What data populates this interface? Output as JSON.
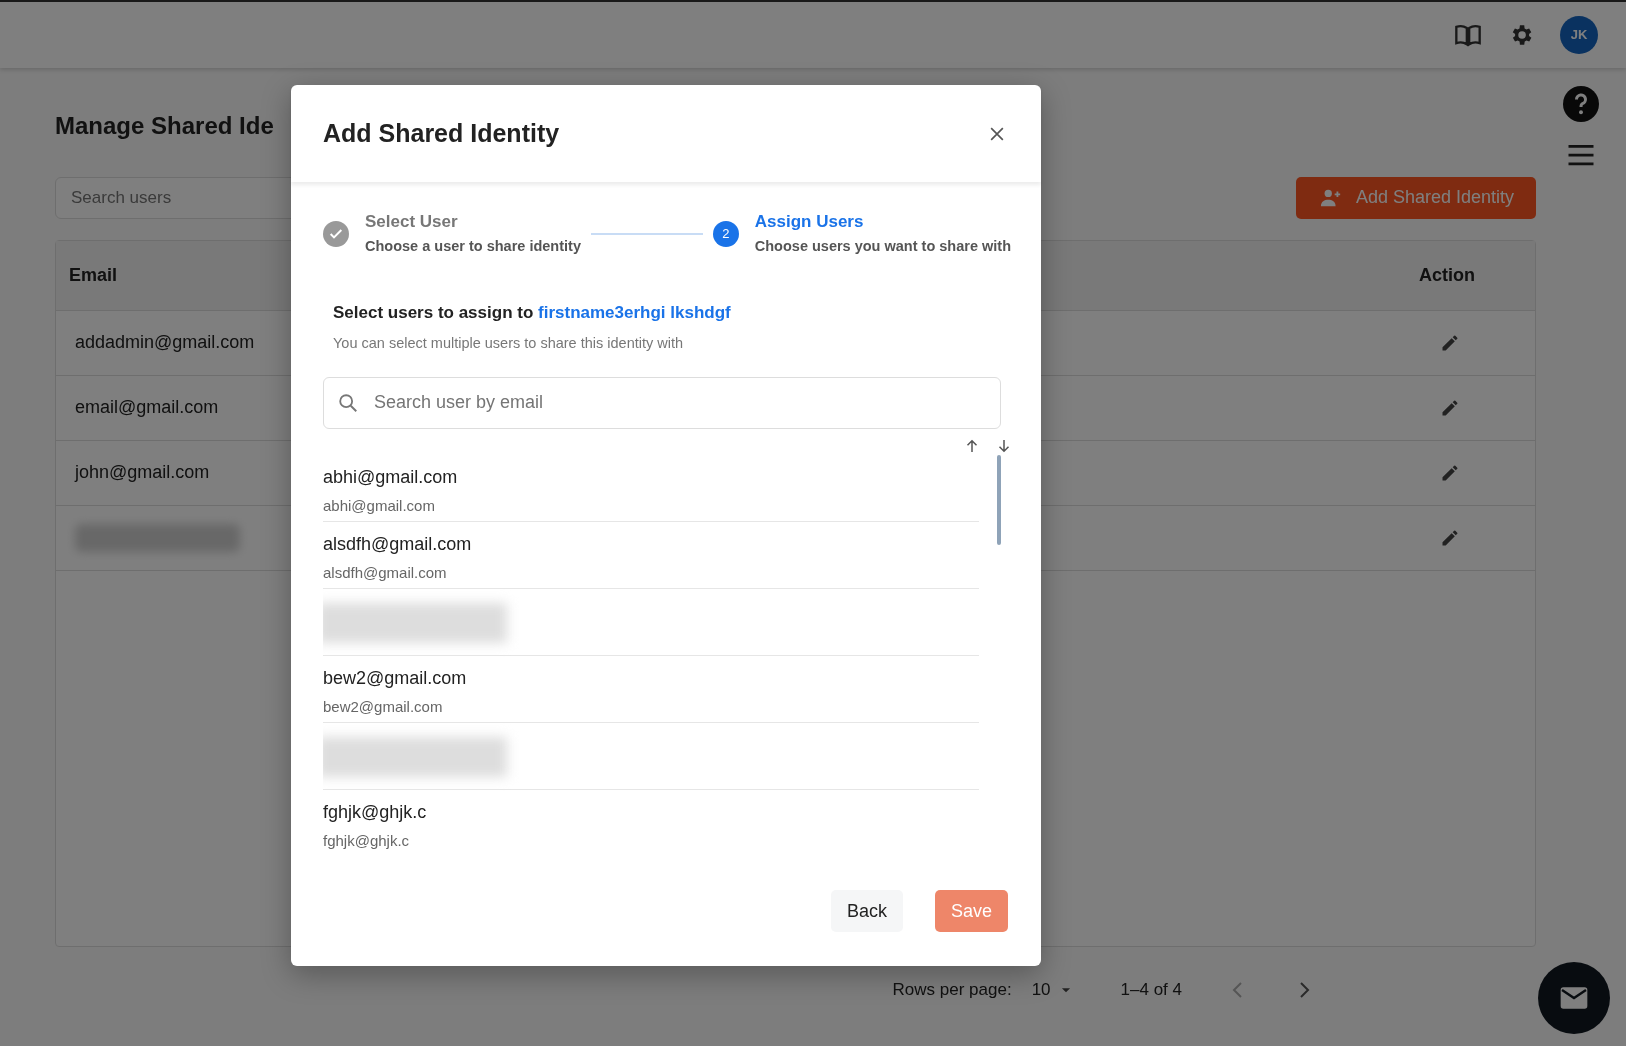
{
  "topbar": {
    "avatar_initials": "JK"
  },
  "page": {
    "title": "Manage Shared Ide",
    "search": {
      "placeholder": "Search users"
    },
    "add_button": "Add Shared Identity"
  },
  "table": {
    "columns": [
      "Email",
      "Action"
    ],
    "rows": [
      {
        "kind": "user",
        "email": "addadmin@gmail.com"
      },
      {
        "kind": "user",
        "email": "email@gmail.com"
      },
      {
        "kind": "user",
        "email": "john@gmail.com"
      },
      {
        "kind": "redacted"
      }
    ]
  },
  "pagination": {
    "rows_label": "Rows per page:",
    "rows_value": "10",
    "range": "1–4 of 4",
    "prev_disabled": true,
    "next_disabled": false
  },
  "modal": {
    "title": "Add Shared Identity",
    "steps": [
      {
        "title": "Select User",
        "subtitle": "Choose a user to share identity",
        "completed": true,
        "selected": false
      },
      {
        "title": "Assign Users",
        "subtitle": "Choose users you want to share with",
        "number": "2",
        "completed": false,
        "selected": true
      }
    ],
    "assign_prefix": "Select users to assign to",
    "assign_name": "firstname3erhgi lkshdgf",
    "hint": "You can select multiple users to share this identity with",
    "search": {
      "placeholder": "Search user by email"
    },
    "users": [
      {
        "kind": "user",
        "name": "abhi@gmail.com",
        "email": "abhi@gmail.com"
      },
      {
        "kind": "user",
        "name": "alsdfh@gmail.com",
        "email": "alsdfh@gmail.com"
      },
      {
        "kind": "redacted"
      },
      {
        "kind": "user",
        "name": "bew2@gmail.com",
        "email": "bew2@gmail.com"
      },
      {
        "kind": "redacted"
      },
      {
        "kind": "user",
        "name": "fghjk@ghjk.c",
        "email": "fghjk@ghjk.c"
      }
    ],
    "buttons": [
      {
        "label": "Back",
        "kind": "secondary",
        "disabled": false
      },
      {
        "label": "Save",
        "kind": "primary",
        "disabled": true
      }
    ]
  }
}
